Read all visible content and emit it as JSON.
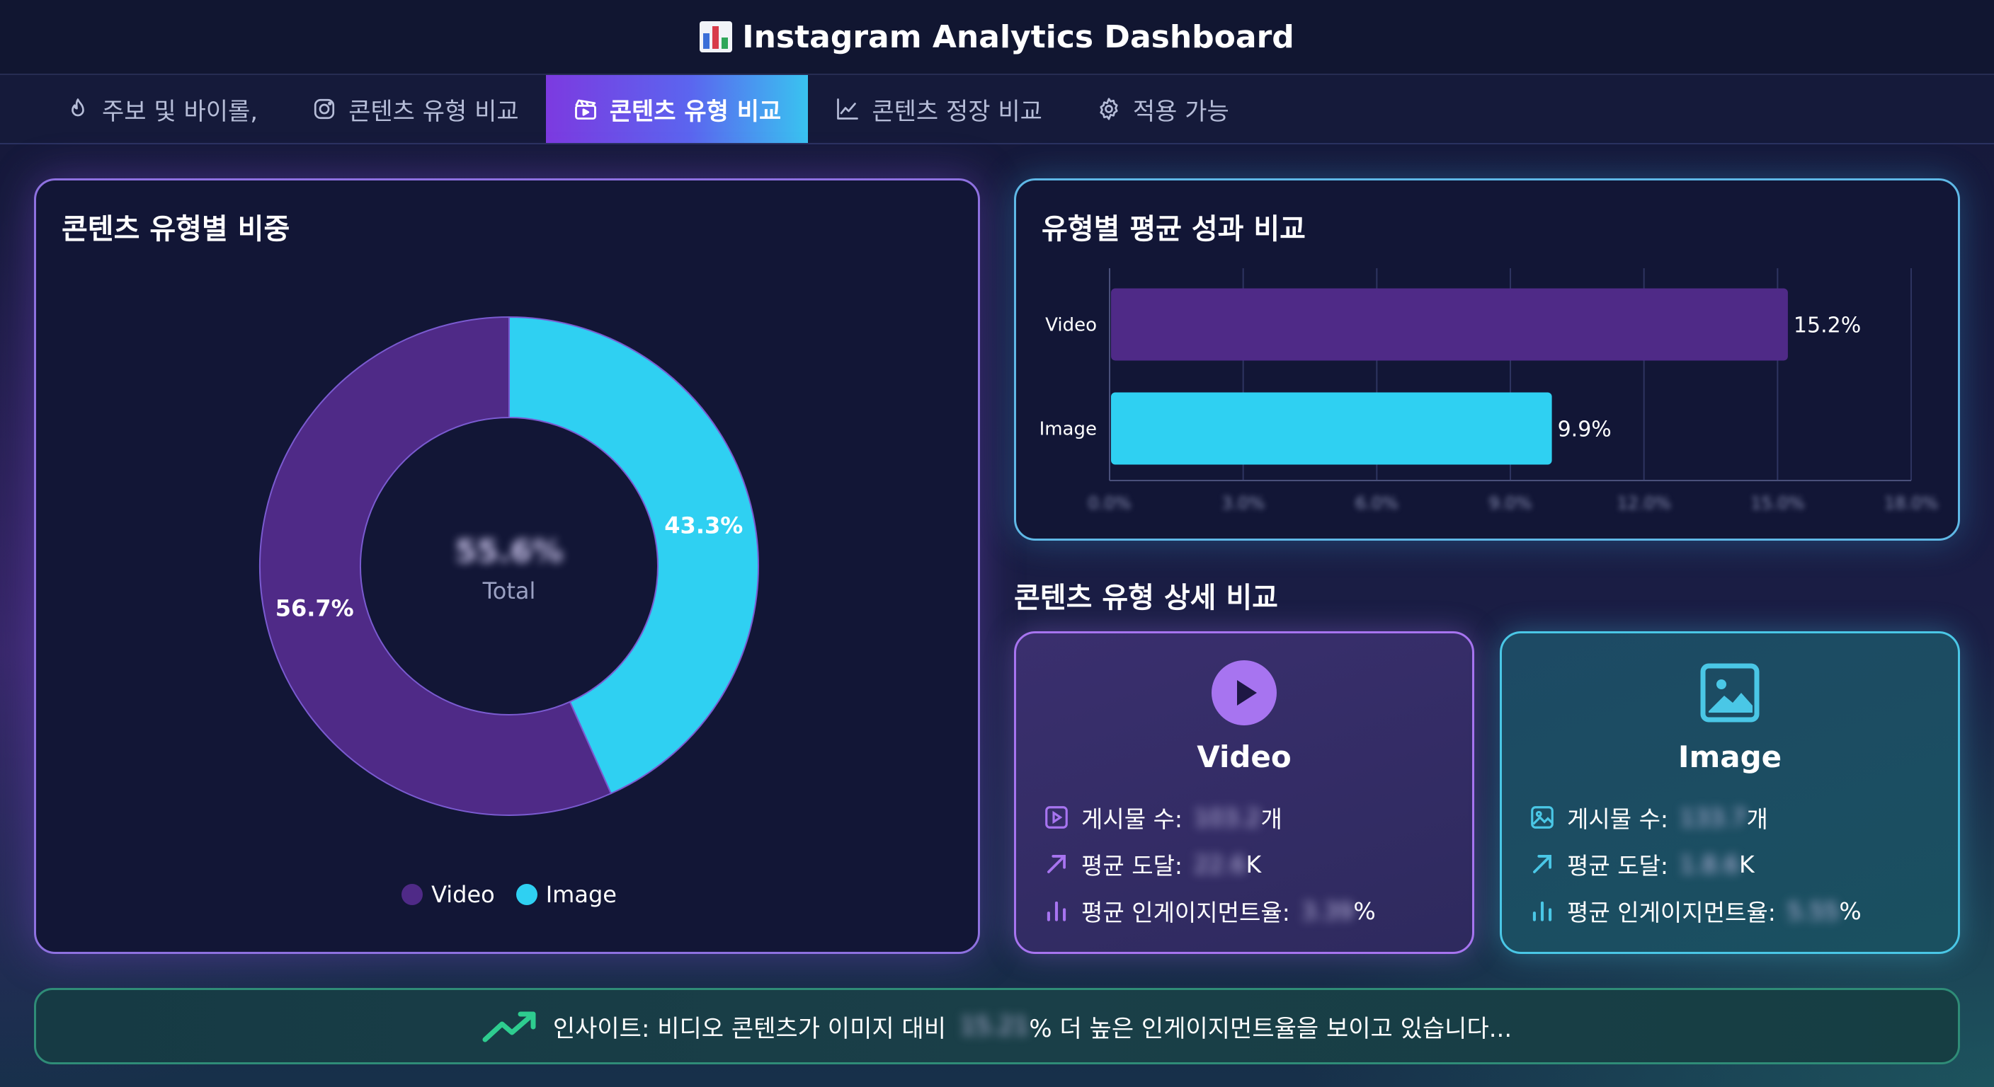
{
  "header": {
    "title": "Instagram Analytics Dashboard",
    "icon": "bar-chart-icon"
  },
  "tabs": [
    {
      "label": "주보 및 바이롤,",
      "icon": "flame-icon",
      "active": false
    },
    {
      "label": "콘텐츠 유형 비교",
      "icon": "instagram-icon",
      "active": false
    },
    {
      "label": "콘텐츠 유형 비교",
      "icon": "clapperboard-icon",
      "active": true
    },
    {
      "label": "콘텐츠 정장 비교",
      "icon": "line-chart-icon",
      "active": false
    },
    {
      "label": "적용 가능",
      "icon": "gear-icon",
      "active": false
    }
  ],
  "donut": {
    "title": "콘텐츠 유형별 비중",
    "center_value": "55.6%",
    "center_label": "Total",
    "legend": [
      {
        "name": "Video",
        "color": "#4f2a87"
      },
      {
        "name": "Image",
        "color": "#2fd0f2"
      }
    ]
  },
  "bar": {
    "title": "유형별 평균 성과 비교"
  },
  "chart_data": [
    {
      "type": "pie",
      "title": "콘텐츠 유형별 비중",
      "categories": [
        "Video",
        "Image"
      ],
      "values": [
        56.7,
        43.3
      ],
      "labels": [
        "56.7%",
        "43.3%"
      ],
      "colors": [
        "#4f2a87",
        "#2fd0f2"
      ],
      "center_value": "55.6%",
      "center_label": "Total",
      "legend": "bottom"
    },
    {
      "type": "bar",
      "title": "유형별 평균 성과 비교",
      "orientation": "horizontal",
      "categories": [
        "Video",
        "Image"
      ],
      "values": [
        15.2,
        9.9
      ],
      "labels": [
        "15.2%",
        "9.9%"
      ],
      "colors": [
        "#4f2a87",
        "#2fd0f2"
      ],
      "x_ticks": [
        "0.0%",
        "3.0%",
        "6.0%",
        "9.0%",
        "12.0%",
        "15.0%",
        "18.0%"
      ],
      "xlim": [
        0,
        18
      ],
      "grid": true
    }
  ],
  "detail": {
    "title": "콘텐츠 유형 상세 비교",
    "video": {
      "title": "Video",
      "posts_label": "게시물 수:",
      "posts_value": "103.2",
      "posts_unit": "개",
      "reach_label": "평균 도달:",
      "reach_value": "22.6",
      "reach_unit": "K",
      "eng_label": "평균 인게이지먼트율:",
      "eng_value": "3.39",
      "eng_unit": "%"
    },
    "image": {
      "title": "Image",
      "posts_label": "게시물 수:",
      "posts_value": "133.7",
      "posts_unit": "개",
      "reach_label": "평균 도달:",
      "reach_value": "1.8.6",
      "reach_unit": "K",
      "eng_label": "평균 인게이지먼트율:",
      "eng_value": "5.55",
      "eng_unit": "%"
    }
  },
  "insight": {
    "prefix": "인사이트: 비디오 콘텐츠가 이미지 대비",
    "value": "15.21",
    "suffix": "% 더 높은 인게이지먼트율을 보이고 있습니다..."
  },
  "colors": {
    "video": "#4f2a87",
    "image": "#2fd0f2",
    "accent_purple": "#a774f0",
    "accent_cyan": "#4ac7e6",
    "insight_green": "#2ecc8f"
  }
}
